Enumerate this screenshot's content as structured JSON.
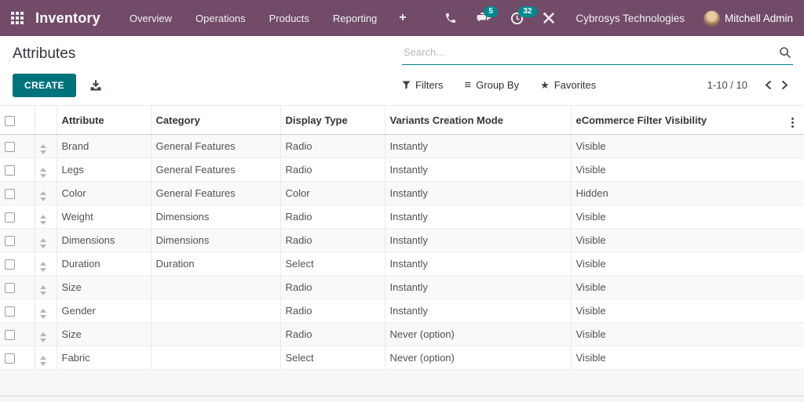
{
  "navbar": {
    "app_name": "Inventory",
    "menu": [
      "Overview",
      "Operations",
      "Products",
      "Reporting"
    ],
    "plus": "+",
    "message_badge": "5",
    "activity_badge": "32",
    "company": "Cybrosys Technologies",
    "user_name": "Mitchell Admin"
  },
  "page": {
    "title": "Attributes",
    "create_button": "CREATE"
  },
  "search": {
    "placeholder": "Search..."
  },
  "controls": {
    "filters": "Filters",
    "group_by": "Group By",
    "favorites": "Favorites",
    "pager": "1-10 / 10"
  },
  "colors": {
    "navbar_bg": "#714B67",
    "badge_bg": "#008A8F",
    "primary_button_bg": "#00737B",
    "search_underline": "#017E84",
    "row_stripe": "#F9F9F9"
  },
  "table": {
    "columns": [
      "Attribute",
      "Category",
      "Display Type",
      "Variants Creation Mode",
      "eCommerce Filter Visibility"
    ],
    "rows": [
      {
        "attribute": "Brand",
        "category": "General Features",
        "display_type": "Radio",
        "variants_creation_mode": "Instantly",
        "ecommerce_filter_visibility": "Visible"
      },
      {
        "attribute": "Legs",
        "category": "General Features",
        "display_type": "Radio",
        "variants_creation_mode": "Instantly",
        "ecommerce_filter_visibility": "Visible"
      },
      {
        "attribute": "Color",
        "category": "General Features",
        "display_type": "Color",
        "variants_creation_mode": "Instantly",
        "ecommerce_filter_visibility": "Hidden"
      },
      {
        "attribute": "Weight",
        "category": "Dimensions",
        "display_type": "Radio",
        "variants_creation_mode": "Instantly",
        "ecommerce_filter_visibility": "Visible"
      },
      {
        "attribute": "Dimensions",
        "category": "Dimensions",
        "display_type": "Radio",
        "variants_creation_mode": "Instantly",
        "ecommerce_filter_visibility": "Visible"
      },
      {
        "attribute": "Duration",
        "category": "Duration",
        "display_type": "Select",
        "variants_creation_mode": "Instantly",
        "ecommerce_filter_visibility": "Visible"
      },
      {
        "attribute": "Size",
        "category": "",
        "display_type": "Radio",
        "variants_creation_mode": "Instantly",
        "ecommerce_filter_visibility": "Visible"
      },
      {
        "attribute": "Gender",
        "category": "",
        "display_type": "Radio",
        "variants_creation_mode": "Instantly",
        "ecommerce_filter_visibility": "Visible"
      },
      {
        "attribute": "Size",
        "category": "",
        "display_type": "Radio",
        "variants_creation_mode": "Never (option)",
        "ecommerce_filter_visibility": "Visible"
      },
      {
        "attribute": "Fabric",
        "category": "",
        "display_type": "Select",
        "variants_creation_mode": "Never (option)",
        "ecommerce_filter_visibility": "Visible"
      }
    ]
  }
}
